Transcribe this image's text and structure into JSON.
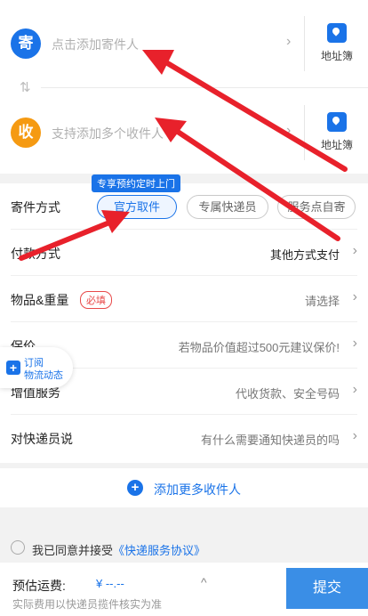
{
  "address": {
    "sender": {
      "badge": "寄",
      "placeholder": "点击添加寄件人",
      "book_label": "地址簿"
    },
    "receiver": {
      "badge": "收",
      "placeholder": "支持添加多个收件人",
      "book_label": "地址簿"
    },
    "swap_glyph": "⇅"
  },
  "options": {
    "method": {
      "label": "寄件方式",
      "tip": "专享预约定时上门",
      "choices": [
        "官方取件",
        "专属快递员",
        "服务点自寄"
      ],
      "selected": "官方取件"
    },
    "payment": {
      "label": "付款方式",
      "value": "其他方式支付"
    },
    "goods": {
      "label": "物品&重量",
      "required_tag": "必填",
      "value": "请选择"
    },
    "insurance": {
      "label": "保价",
      "value": "若物品价值超过500元建议保价!"
    },
    "value_added": {
      "label": "增值服务",
      "value": "代收货款、安全号码"
    },
    "note": {
      "label": "对快递员说",
      "value": "有什么需要通知快递员的吗"
    }
  },
  "floating_subscribe": {
    "line1": "订阅",
    "line2": "物流动态"
  },
  "add_more": {
    "label": "添加更多收件人"
  },
  "agreement": {
    "prefix": "我已同意并接受",
    "link": "《快递服务协议》"
  },
  "fee": {
    "label": "预估运费:",
    "value": "¥ --.--",
    "note": "实际费用以快递员揽件核实为准",
    "submit_label": "提交"
  },
  "colors": {
    "accent": "#1a73e8",
    "orange": "#f59a12",
    "required": "#e84a4a",
    "annotation": "#e8212b"
  },
  "icons": {
    "address_book": "address-book-icon",
    "chevron": "chevron-right-icon",
    "swap": "swap-icon",
    "add": "plus-circle-icon",
    "radio": "radio-unchecked-icon"
  }
}
